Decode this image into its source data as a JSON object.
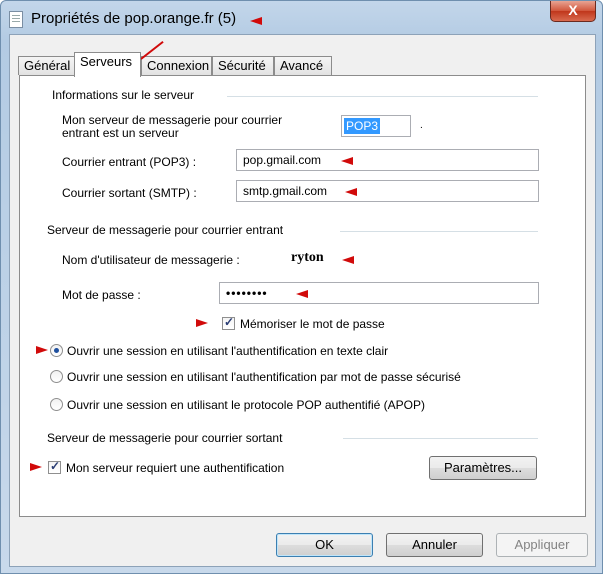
{
  "window": {
    "title": "Propriétés de pop.orange.fr (5)",
    "close_label": "X"
  },
  "tabs": [
    {
      "label": "Général",
      "active": false
    },
    {
      "label": "Serveurs",
      "active": true
    },
    {
      "label": "Connexion",
      "active": false
    },
    {
      "label": "Sécurité",
      "active": false
    },
    {
      "label": "Avancé",
      "active": false
    }
  ],
  "server_info": {
    "group_label": "Informations sur le serveur",
    "incoming_type_label_line1": "Mon serveur de messagerie pour courrier",
    "incoming_type_label_line2": "entrant est un serveur",
    "incoming_type_value": "POP3",
    "incoming_label": "Courrier entrant (POP3) :",
    "incoming_value": "pop.gmail.com",
    "outgoing_label": "Courrier sortant (SMTP) :",
    "outgoing_value": "smtp.gmail.com"
  },
  "incoming_server": {
    "group_label": "Serveur de messagerie pour courrier entrant",
    "username_label": "Nom d'utilisateur de messagerie :",
    "username_value": "ryton",
    "password_label": "Mot de passe :",
    "password_value": "••••••••",
    "remember_label": "Mémoriser le mot de passe",
    "remember_checked": true
  },
  "auth_options": [
    {
      "label": "Ouvrir une session en utilisant l'authentification en texte clair",
      "selected": true
    },
    {
      "label": "Ouvrir une session en utilisant l'authentification par mot de passe sécurisé",
      "selected": false
    },
    {
      "label": "Ouvrir une session en utilisant le protocole POP authentifié (APOP)",
      "selected": false
    }
  ],
  "outgoing_server": {
    "group_label": "Serveur de messagerie pour courrier sortant",
    "auth_required_label": "Mon serveur requiert une authentification",
    "auth_required_checked": true,
    "settings_button": "Paramètres..."
  },
  "footer": {
    "ok": "OK",
    "cancel": "Annuler",
    "apply": "Appliquer"
  },
  "colors": {
    "annotation_red": "#d10a0a",
    "selection_blue": "#3399ff"
  }
}
